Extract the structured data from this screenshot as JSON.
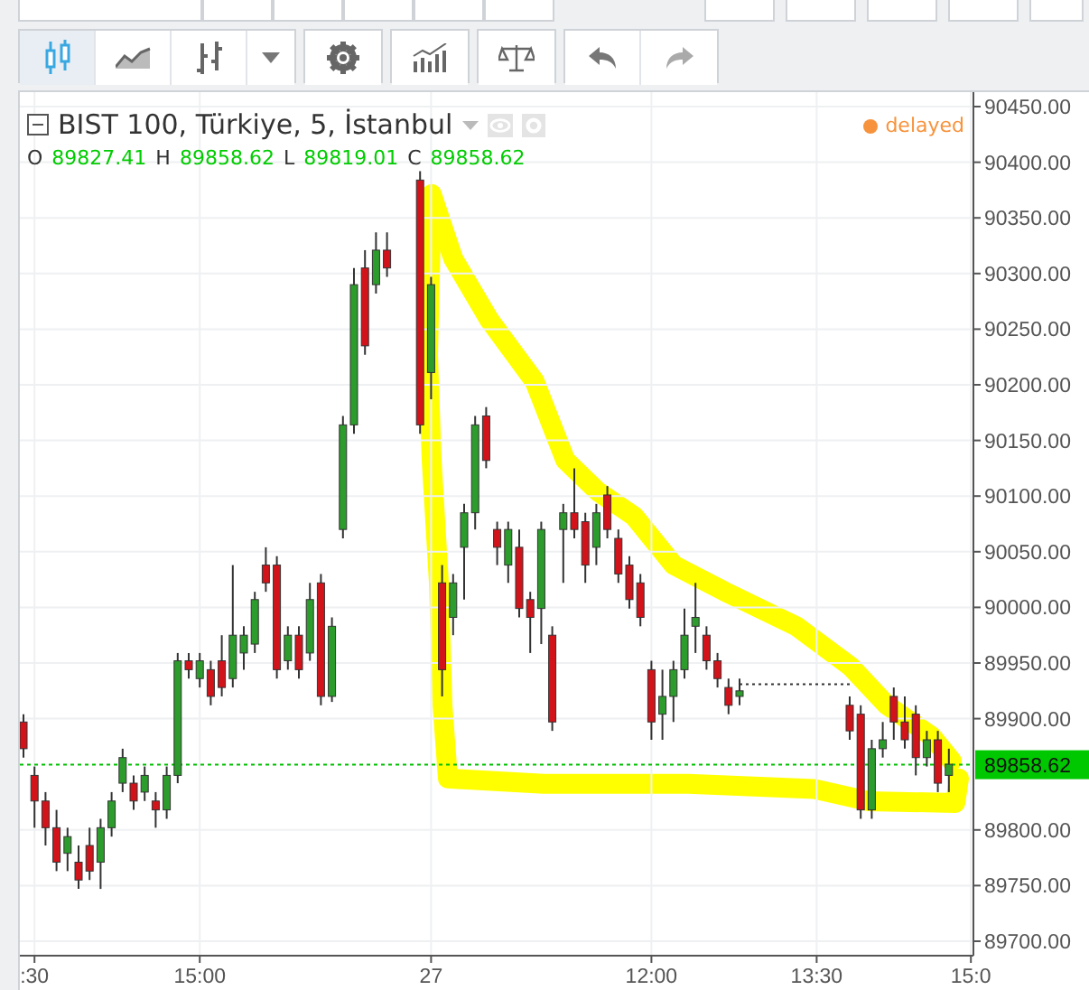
{
  "toolbar": {
    "buttons": [
      {
        "kind": "candles",
        "selected": true
      },
      {
        "kind": "area",
        "selected": false
      },
      {
        "kind": "bars",
        "selected": false
      },
      {
        "kind": "caret",
        "selected": false
      },
      {
        "kind": "settings",
        "selected": false
      },
      {
        "kind": "indicators",
        "selected": false
      },
      {
        "kind": "scales",
        "selected": false
      },
      {
        "kind": "undo",
        "selected": false
      },
      {
        "kind": "redo",
        "selected": false
      }
    ]
  },
  "legend": {
    "title": "BIST 100, Türkiye, 5, İstanbul",
    "status": "delayed",
    "ohlc": [
      {
        "label": "O",
        "value": "89827.41"
      },
      {
        "label": "H",
        "value": "89858.62"
      },
      {
        "label": "L",
        "value": "89819.01"
      },
      {
        "label": "C",
        "value": "89858.62"
      }
    ]
  },
  "chart_data": {
    "type": "candlestick",
    "ylim": [
      89687,
      90463
    ],
    "grid": true,
    "ref_lines": [
      {
        "axis": "y",
        "value": 89931,
        "color": "#333333"
      },
      {
        "axis": "y",
        "value": 89858.62,
        "color": "#00c000"
      }
    ],
    "categories": [
      null,
      ":30",
      null,
      null,
      null,
      null,
      null,
      null,
      null,
      null,
      null,
      null,
      null,
      null,
      null,
      null,
      "15:00",
      null,
      null,
      null,
      null,
      null,
      null,
      null,
      null,
      null,
      null,
      null,
      null,
      null,
      null,
      null,
      null,
      null,
      null,
      null,
      null,
      "27",
      null,
      null,
      null,
      null,
      null,
      null,
      null,
      null,
      null,
      null,
      null,
      null,
      null,
      null,
      null,
      null,
      null,
      null,
      null,
      "12:00",
      null,
      null,
      null,
      null,
      null,
      null,
      null,
      null,
      null,
      null,
      null,
      null,
      null,
      null,
      "13:30",
      null,
      null,
      null,
      null,
      null,
      null,
      null,
      null,
      null,
      null,
      null,
      null,
      null,
      "15:0"
    ],
    "yticks": [
      {
        "value": 90450,
        "label": "90450.00"
      },
      {
        "value": 90400,
        "label": "90400.00"
      },
      {
        "value": 90350,
        "label": "90350.00"
      },
      {
        "value": 90300,
        "label": "90300.00"
      },
      {
        "value": 90250,
        "label": "90250.00"
      },
      {
        "value": 90200,
        "label": "90200.00"
      },
      {
        "value": 90150,
        "label": "90150.00"
      },
      {
        "value": 90100,
        "label": "90100.00"
      },
      {
        "value": 90050,
        "label": "90050.00"
      },
      {
        "value": 90000,
        "label": "90000.00"
      },
      {
        "value": 89950,
        "label": "89950.00"
      },
      {
        "value": 89900,
        "label": "89900.00"
      },
      {
        "value": 89800,
        "label": "89800.00"
      },
      {
        "value": 89750,
        "label": "89750.00"
      },
      {
        "value": 89700,
        "label": "89700.00"
      }
    ],
    "ohlc": [
      [
        89897,
        89904,
        89865,
        89873
      ],
      [
        89849,
        89857,
        89802,
        89826
      ],
      [
        89826,
        89834,
        89786,
        89802
      ],
      [
        89802,
        89818,
        89763,
        89771
      ],
      [
        89779,
        89802,
        89763,
        89794
      ],
      [
        89771,
        89786,
        89747,
        89755
      ],
      [
        89786,
        89802,
        89755,
        89763
      ],
      [
        89771,
        89810,
        89747,
        89802
      ],
      [
        89802,
        89834,
        89794,
        89826
      ],
      [
        89842,
        89873,
        89834,
        89865
      ],
      [
        89842,
        89849,
        89818,
        89826
      ],
      [
        89834,
        89857,
        89826,
        89849
      ],
      [
        89826,
        89834,
        89802,
        89818
      ],
      [
        89818,
        89857,
        89810,
        89849
      ],
      [
        89849,
        89959,
        89842,
        89952
      ],
      [
        89952,
        89959,
        89936,
        89944
      ],
      [
        89936,
        89959,
        89928,
        89952
      ],
      [
        89944,
        89952,
        89912,
        89920
      ],
      [
        89952,
        89975,
        89920,
        89928
      ],
      [
        89936,
        90038,
        89928,
        89975
      ],
      [
        89959,
        89983,
        89944,
        89975
      ],
      [
        89967,
        90014,
        89959,
        90007
      ],
      [
        90038,
        90054,
        90014,
        90022
      ],
      [
        90038,
        90046,
        89936,
        89944
      ],
      [
        89952,
        89983,
        89944,
        89975
      ],
      [
        89975,
        89983,
        89936,
        89944
      ],
      [
        89959,
        90022,
        89952,
        90007
      ],
      [
        90022,
        90030,
        89912,
        89920
      ],
      [
        89920,
        89991,
        89915,
        89983
      ],
      [
        90070,
        90172,
        90062,
        90164
      ],
      [
        90164,
        90305,
        90156,
        90290
      ],
      [
        90305,
        90321,
        90227,
        90235
      ],
      [
        90290,
        90337,
        90282,
        90321
      ],
      [
        90321,
        90337,
        90297,
        90305
      ],
      null,
      null,
      [
        90384,
        90392,
        90156,
        90164
      ],
      [
        90211,
        90297,
        90187,
        90290
      ],
      [
        90022,
        90038,
        89920,
        89944
      ],
      [
        89991,
        90030,
        89975,
        90022
      ],
      [
        90054,
        90093,
        90007,
        90085
      ],
      [
        90085,
        90172,
        90070,
        90164
      ],
      [
        90172,
        90180,
        90125,
        90132
      ],
      [
        90070,
        90077,
        90038,
        90054
      ],
      [
        90038,
        90077,
        90022,
        90070
      ],
      [
        90054,
        90070,
        89991,
        89999
      ],
      [
        90007,
        90014,
        89959,
        89991
      ],
      [
        89999,
        90077,
        89967,
        90070
      ],
      [
        89975,
        89983,
        89889,
        89897
      ],
      [
        90070,
        90093,
        90022,
        90085
      ],
      [
        90085,
        90125,
        90062,
        90070
      ],
      [
        90077,
        90085,
        90022,
        90038
      ],
      [
        90054,
        90093,
        90038,
        90085
      ],
      [
        90101,
        90109,
        90062,
        90070
      ],
      [
        90062,
        90070,
        90022,
        90030
      ],
      [
        90038,
        90046,
        89999,
        90007
      ],
      [
        90022,
        90030,
        89983,
        89991
      ],
      [
        89944,
        89952,
        89881,
        89897
      ],
      [
        89904,
        89944,
        89881,
        89920
      ],
      [
        89920,
        89952,
        89897,
        89944
      ],
      [
        89944,
        89999,
        89936,
        89975
      ],
      [
        89983,
        90022,
        89959,
        89991
      ],
      [
        89975,
        89983,
        89944,
        89952
      ],
      [
        89952,
        89959,
        89928,
        89936
      ],
      [
        89928,
        89936,
        89904,
        89912
      ],
      [
        89920,
        89936,
        89912,
        89925
      ],
      null,
      null,
      null,
      null,
      null,
      null,
      null,
      null,
      null,
      [
        89912,
        89920,
        89881,
        89889
      ],
      [
        89904,
        89912,
        89810,
        89818
      ],
      [
        89818,
        89881,
        89810,
        89873
      ],
      [
        89873,
        89897,
        89865,
        89881
      ],
      [
        89920,
        89928,
        89881,
        89897
      ],
      [
        89897,
        89920,
        89873,
        89881
      ],
      [
        89904,
        89912,
        89849,
        89865
      ],
      [
        89865,
        89889,
        89857,
        89881
      ],
      [
        89881,
        89889,
        89834,
        89842
      ],
      [
        89849,
        89873,
        89834,
        89859
      ],
      null,
      null
    ]
  },
  "price_axis": {
    "current_price": "89858.62"
  }
}
